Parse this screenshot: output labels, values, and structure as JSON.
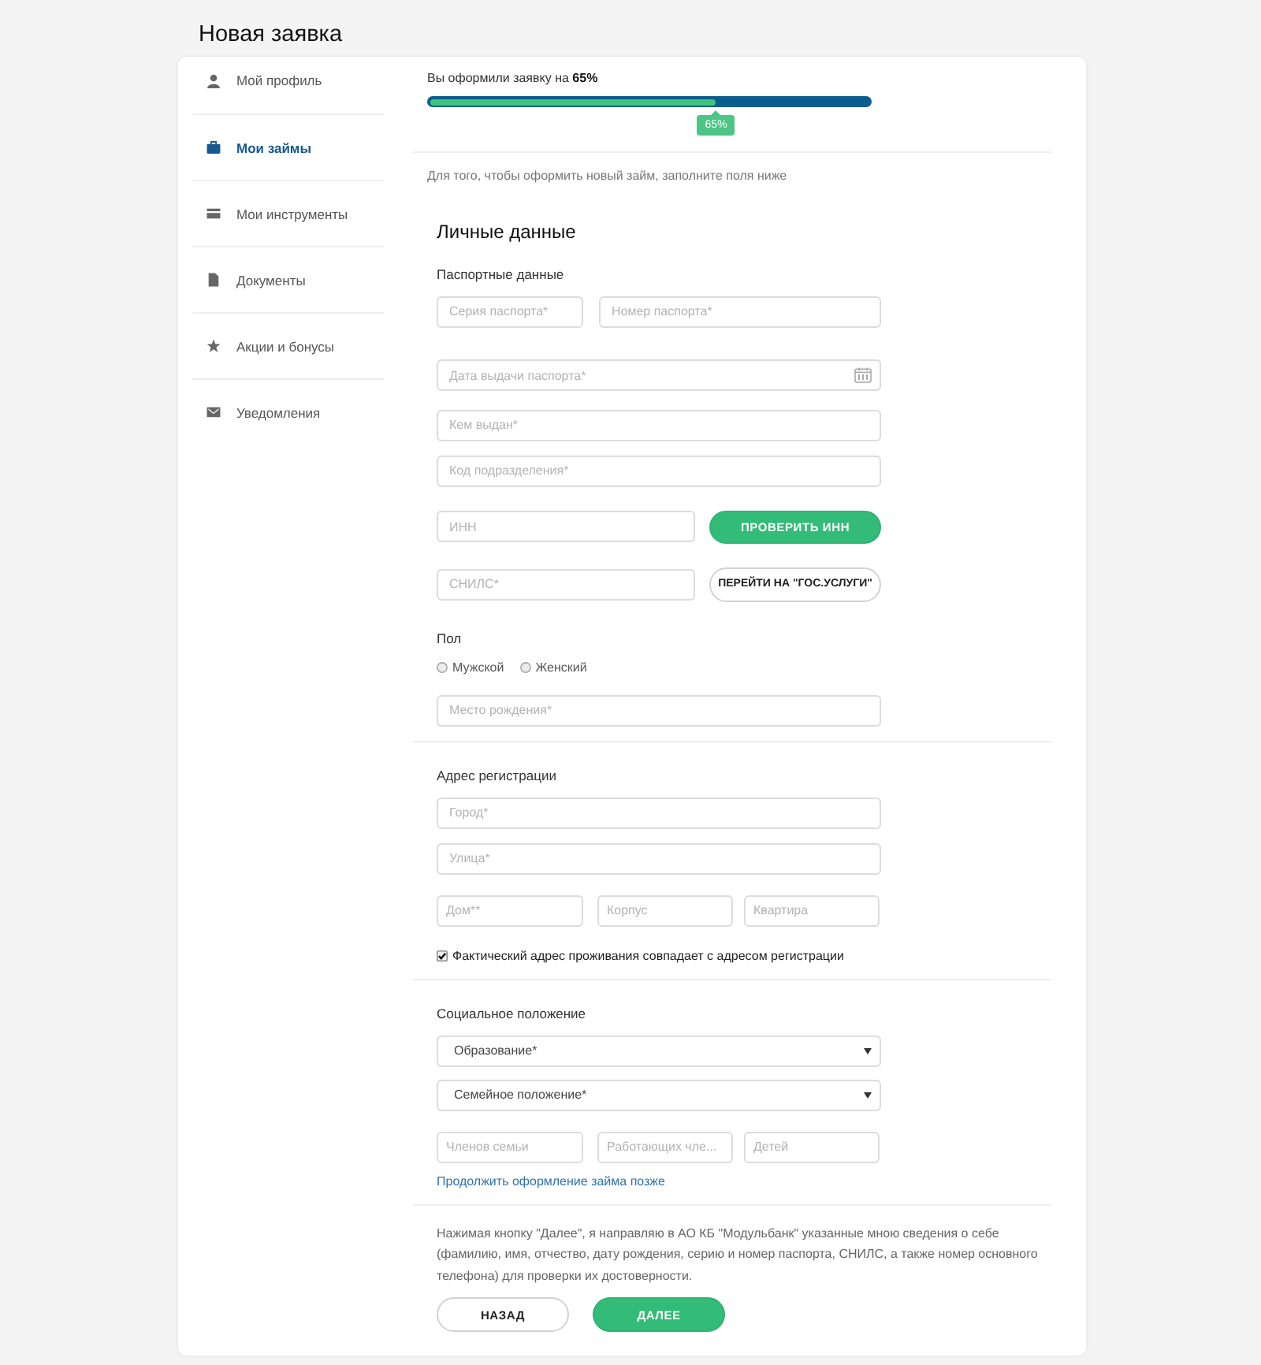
{
  "page": {
    "title": "Новая заявка"
  },
  "sidebar": {
    "items": [
      {
        "kind": "profile",
        "label": "Мой профиль",
        "selected": false
      },
      {
        "kind": "loans",
        "label": "Мои займы",
        "selected": true
      },
      {
        "kind": "tools",
        "label": "Мои инструменты",
        "selected": false
      },
      {
        "kind": "documents",
        "label": "Документы",
        "selected": false
      },
      {
        "kind": "promotions",
        "label": "Акции и бонусы",
        "selected": false
      },
      {
        "kind": "notifications",
        "label": "Уведомления",
        "selected": false
      }
    ]
  },
  "progress": {
    "caption": "Вы оформили заявку на **65%**",
    "level": 0.65,
    "badge": "65%"
  },
  "intro": "Для того, чтобы оформить новый займ, заполните поля ниже",
  "form": {
    "title": "Личные данные",
    "sections": [
      {
        "heading": "Паспортные данные",
        "items": [
          {
            "kind": "fields",
            "fields": [
              {
                "placeholder": "Серия паспорта*"
              },
              {
                "placeholder": "Номер паспорта*"
              }
            ]
          },
          {
            "kind": "date",
            "placeholder": "Дата выдачи паспорта*"
          },
          {
            "kind": "fields",
            "fields": [
              {
                "placeholder": "Кем выдан*"
              }
            ]
          },
          {
            "kind": "fields",
            "fields": [
              {
                "placeholder": "Код подразделения*"
              }
            ]
          },
          {
            "kind": "field_button",
            "field": {
              "placeholder": "ИНН"
            },
            "button": {
              "kind": "primary",
              "label": "ПРОВЕРИТЬ ИНН"
            }
          },
          {
            "kind": "field_button",
            "field": {
              "placeholder": "СНИЛС*"
            },
            "button": {
              "kind": "secondary",
              "label": "ПЕРЕЙТИ НА \"ГОС.УСЛУГИ\""
            }
          },
          {
            "kind": "radios",
            "label": "Пол",
            "options": [
              {
                "label": "Мужской",
                "selected": false
              },
              {
                "label": "Женский",
                "selected": false
              }
            ]
          },
          {
            "kind": "fields",
            "fields": [
              {
                "placeholder": "Место рождения*"
              }
            ]
          }
        ]
      },
      {
        "heading": "Адрес регистрации",
        "items": [
          {
            "kind": "fields",
            "fields": [
              {
                "placeholder": "Город*"
              }
            ]
          },
          {
            "kind": "fields",
            "fields": [
              {
                "placeholder": "Улица*"
              }
            ]
          },
          {
            "kind": "fields",
            "fields": [
              {
                "placeholder": "Дом**"
              },
              {
                "placeholder": "Корпус"
              },
              {
                "placeholder": "Квартира"
              }
            ]
          },
          {
            "kind": "checkbox",
            "label": "Фактический адрес проживания совпадает с адресом регистрации",
            "checked": true
          }
        ]
      },
      {
        "heading": "Социальное положение",
        "items": [
          {
            "kind": "select",
            "value": "Образование*"
          },
          {
            "kind": "select",
            "value": "Семейное положение*"
          },
          {
            "kind": "fields",
            "fields": [
              {
                "placeholder": "Членов семьи"
              },
              {
                "placeholder": "Работающих чле..."
              },
              {
                "placeholder": "Детей"
              }
            ]
          },
          {
            "kind": "link",
            "label": "Продолжить оформление займа позже"
          }
        ]
      }
    ],
    "consent": "Нажимая кнопку \"Далее\", я направляю в АО КБ \"Модульбанк\" указанные мною сведения о себе (фамилию, имя, отчество, дату рождения, серию и номер паспорта, СНИЛС, а также номер основного телефона) для проверки их достоверности.",
    "buttons": [
      {
        "kind": "secondary",
        "label": "НАЗАД"
      },
      {
        "kind": "primary",
        "label": "ДАЛЕЕ"
      }
    ]
  }
}
